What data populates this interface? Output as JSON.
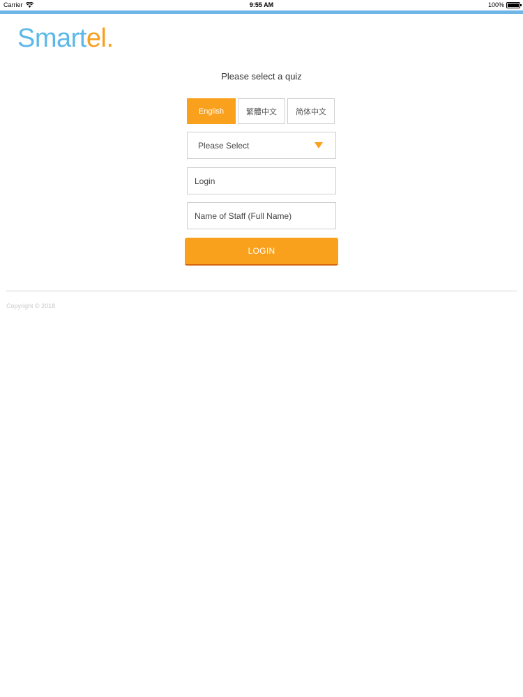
{
  "status_bar": {
    "carrier": "Carrier",
    "wifi_icon": "wifi-icon",
    "time": "9:55 AM",
    "battery": "100%",
    "battery_icon": "battery-icon"
  },
  "colors": {
    "accent_orange": "#f9a11d",
    "brand_blue": "#5cb8e8",
    "top_bar": "#6fb5e6"
  },
  "logo": {
    "part1": "Smart",
    "part2": "el",
    "part3": "."
  },
  "form": {
    "subtitle": "Please select a quiz",
    "languages": [
      {
        "label": "English",
        "selected": true
      },
      {
        "label": "繁體中文",
        "selected": false
      },
      {
        "label": "简体中文",
        "selected": false
      }
    ],
    "quiz_select": {
      "value": "Please Select",
      "icon": "triangle-down-icon"
    },
    "login_placeholder": "Login",
    "name_placeholder": "Name of Staff (Full Name)",
    "login_button": "LOGIN"
  },
  "footer": {
    "copyright": "Copyright © 2018"
  }
}
